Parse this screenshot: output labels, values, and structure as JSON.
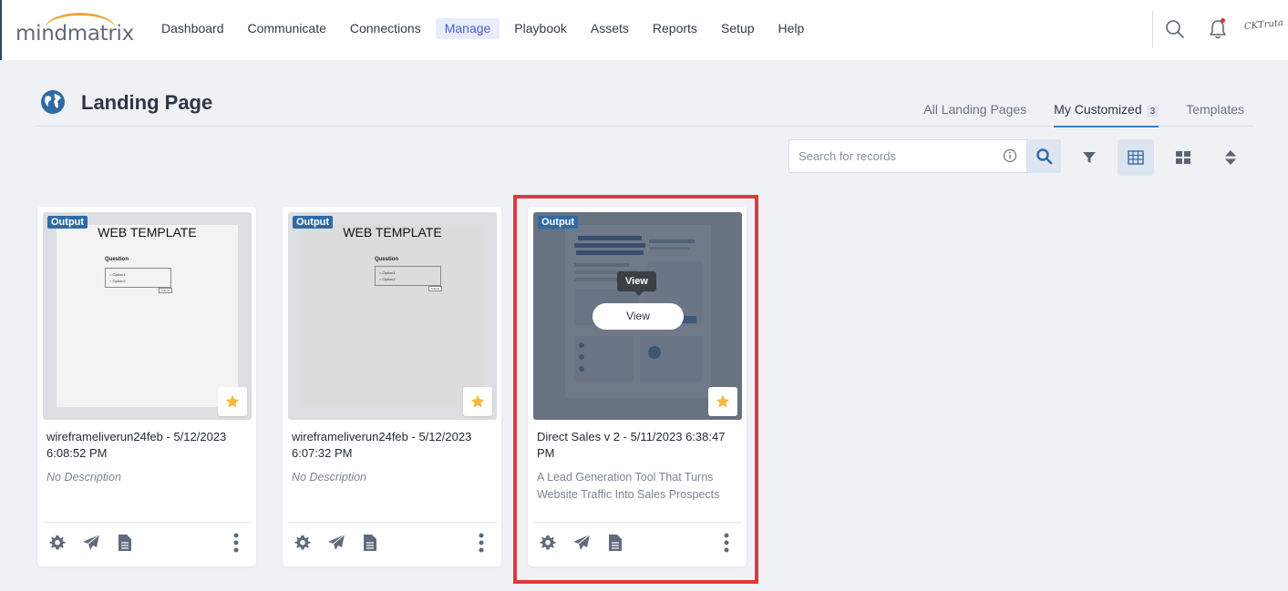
{
  "brand": {
    "logo_text": "mindmatrix",
    "arc_color": "#f2a43a"
  },
  "nav": {
    "items": [
      {
        "label": "Dashboard"
      },
      {
        "label": "Communicate"
      },
      {
        "label": "Connections"
      },
      {
        "label": "Manage",
        "active": true
      },
      {
        "label": "Playbook"
      },
      {
        "label": "Assets"
      },
      {
        "label": "Reports"
      },
      {
        "label": "Setup"
      },
      {
        "label": "Help"
      }
    ]
  },
  "header": {
    "search_icon": "search-icon",
    "bell_icon": "bell-icon",
    "signature": "CKTruta"
  },
  "page": {
    "title": "Landing Page",
    "icon": "globe-icon",
    "tabs": [
      {
        "label": "All Landing Pages",
        "active": false
      },
      {
        "label": "My Customized",
        "badge": "3",
        "active": true
      },
      {
        "label": "Templates",
        "active": false
      }
    ]
  },
  "toolbar": {
    "search_placeholder": "Search for records",
    "icons": [
      "info-icon",
      "search-icon",
      "filter-icon",
      "list-view-icon",
      "grid-view-icon",
      "sort-icon"
    ]
  },
  "cards": [
    {
      "tag": "Output",
      "thumb_title": "WEB TEMPLATE",
      "thumb_question": "Question",
      "thumb_options": [
        "Option1",
        "Option2"
      ],
      "thumb_submit": "Submit",
      "title": "wireframeliverun24feb - 5/12/2023 6:08:52 PM",
      "description": "No Description"
    },
    {
      "tag": "Output",
      "thumb_title": "WEB TEMPLATE",
      "thumb_question": "Question",
      "thumb_options": [
        "Option1",
        "Option2"
      ],
      "thumb_submit": "Submit",
      "title": "wireframeliverun24feb - 5/12/2023 6:07:32 PM",
      "description": "No Description"
    },
    {
      "tag": "Output",
      "title": "Direct Sales v 2 - 5/11/2023 6:38:47 PM",
      "description": "A Lead Generation Tool That Turns Website Traffic Into Sales Prospects",
      "tooltip": "View",
      "view_button": "View"
    }
  ],
  "colors": {
    "accent": "#3d7fc1",
    "highlight": "#e03a3a",
    "star": "#f4b940",
    "tag": "#2f6aa6"
  }
}
